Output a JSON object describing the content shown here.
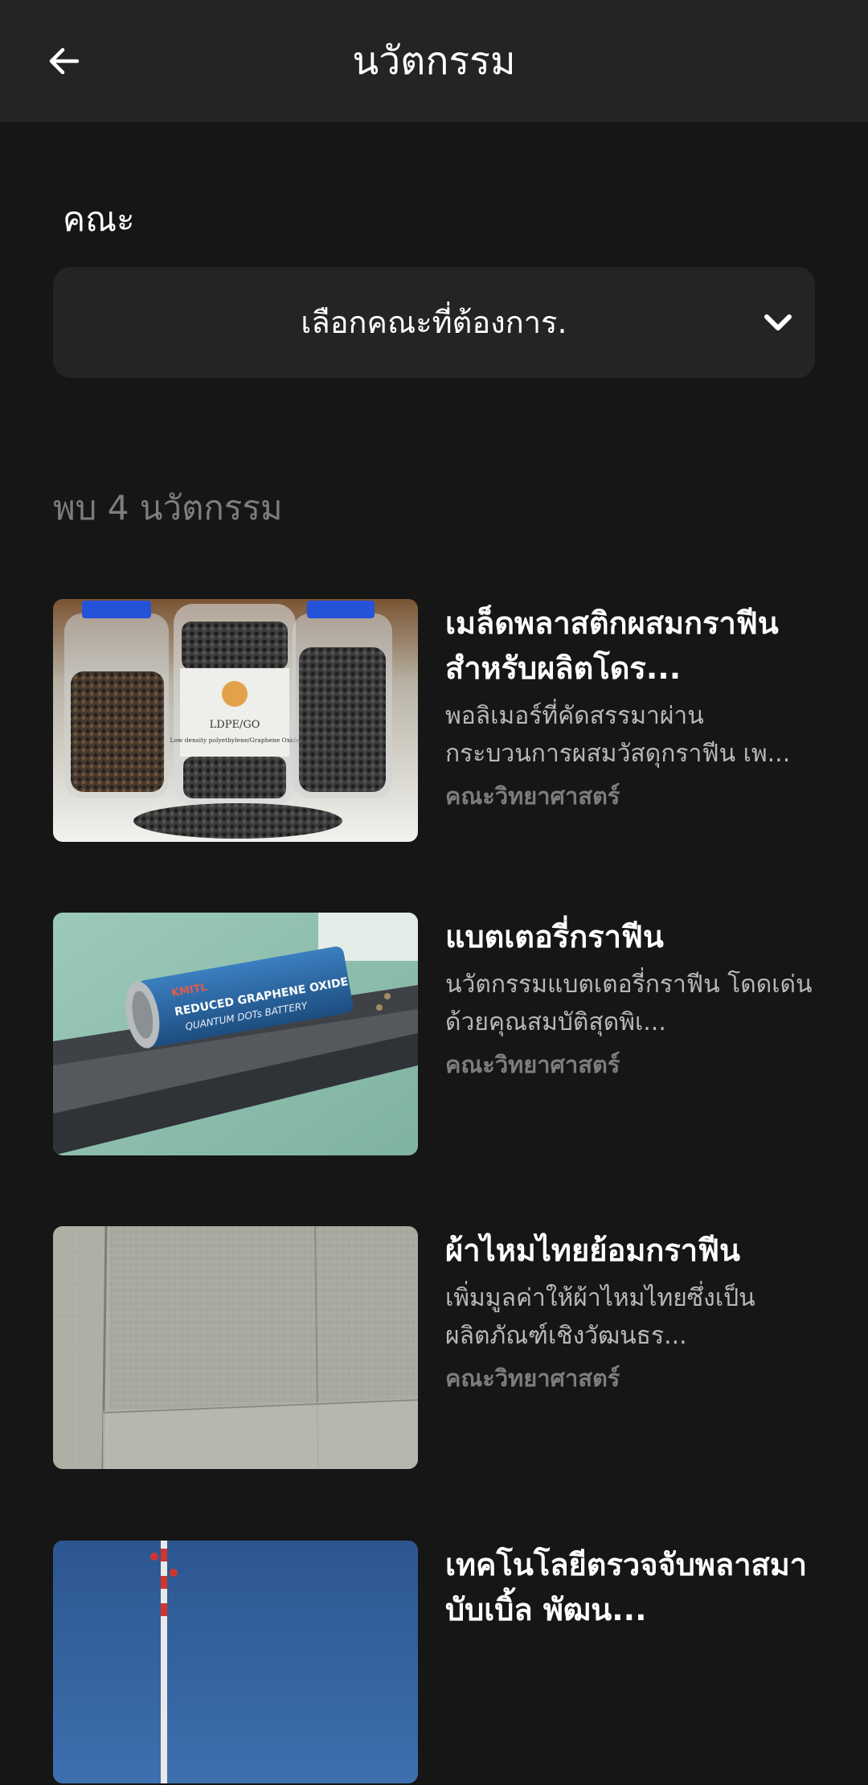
{
  "header": {
    "title": "นวัตกรรม",
    "back_icon": "arrow-left"
  },
  "filter": {
    "label": "คณะ",
    "placeholder": "เลือกคณะที่ต้องการ.",
    "icon": "chevron-down"
  },
  "results": {
    "count_text": "พบ 4 นวัตกรรม"
  },
  "items": [
    {
      "title": "เมล็ดพลาสติกผสมกราฟีนสำหรับผลิตโดร...",
      "description": "พอลิเมอร์ที่คัดสรรมาผ่านกระบวนการผสมวัสดุกราฟีน เพ...",
      "faculty": "คณะวิทยาศาสตร์",
      "image": "glass-jars-of-plastic-pellets",
      "image_text": {
        "label_line1": "LDPE/GO",
        "label_line2": "Low density polyethylene/Graphene Oxide"
      }
    },
    {
      "title": "แบตเตอรี่กราฟีน",
      "description": "นวัตกรรมแบตเตอรี่กราฟีน โดดเด่นด้วยคุณสมบัติสุดพิเ...",
      "faculty": "คณะวิทยาศาสตร์",
      "image": "graphene-battery-cell",
      "image_text": {
        "brand": "KMITL",
        "line1": "REDUCED GRAPHENE OXIDE",
        "line2": "QUANTUM DOTs BATTERY"
      }
    },
    {
      "title": "ผ้าไหมไทยย้อมกราฟีน",
      "description": "เพิ่มมูลค่าให้ผ้าไหมไทยซึ่งเป็นผลิตภัณฑ์เชิงวัฒนธร...",
      "faculty": "คณะวิทยาศาสตร์",
      "image": "folded-grey-silk-fabric"
    },
    {
      "title": "เทคโนโลยีตรวจจับพลาสมาบับเบิ้ล พัฒน...",
      "description": "",
      "faculty": "",
      "image": "antenna-tower-under-blue-sky"
    }
  ],
  "colors": {
    "background": "#161616",
    "app_bar": "#242424",
    "select_bg": "#242424",
    "primary_text": "#ffffff",
    "secondary_text": "#b8b8b8",
    "muted_text": "#7d7d7d"
  }
}
